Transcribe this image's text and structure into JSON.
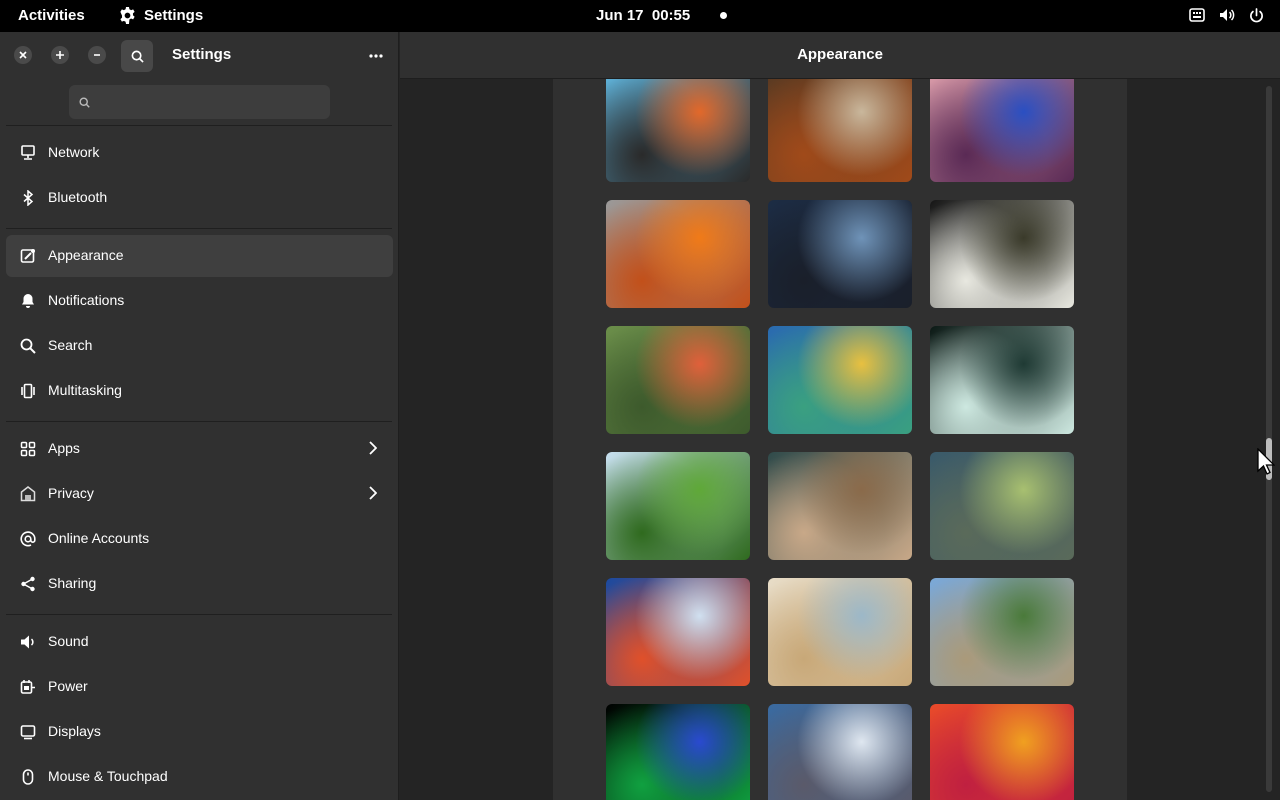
{
  "topbar": {
    "activities": "Activities",
    "app_name": "Settings",
    "clock": "Jun 17  00:55"
  },
  "sidebar": {
    "title": "Settings",
    "search_placeholder": "",
    "groups": [
      [
        {
          "label": "Network",
          "icon": "network-icon"
        },
        {
          "label": "Bluetooth",
          "icon": "bluetooth-icon"
        }
      ],
      [
        {
          "label": "Appearance",
          "icon": "appearance-icon",
          "active": true
        },
        {
          "label": "Notifications",
          "icon": "bell-icon"
        },
        {
          "label": "Search",
          "icon": "search-icon"
        },
        {
          "label": "Multitasking",
          "icon": "multitasking-icon"
        }
      ],
      [
        {
          "label": "Apps",
          "icon": "apps-icon",
          "chevron": true
        },
        {
          "label": "Privacy",
          "icon": "privacy-icon",
          "chevron": true
        },
        {
          "label": "Online Accounts",
          "icon": "at-icon"
        },
        {
          "label": "Sharing",
          "icon": "share-icon"
        }
      ],
      [
        {
          "label": "Sound",
          "icon": "speaker-icon"
        },
        {
          "label": "Power",
          "icon": "power-plug-icon"
        },
        {
          "label": "Displays",
          "icon": "display-icon"
        },
        {
          "label": "Mouse & Touchpad",
          "icon": "mouse-icon"
        }
      ]
    ]
  },
  "main": {
    "title": "Appearance"
  },
  "wallpapers": [
    {
      "name": "graffiti-wallpaper",
      "colors": [
        "#5fb2d9",
        "#e2682a",
        "#2a2a2a"
      ]
    },
    {
      "name": "mushrooms-wallpaper",
      "colors": [
        "#5a3a22",
        "#c9b79c",
        "#a04a1a"
      ]
    },
    {
      "name": "turntable-wallpaper",
      "colors": [
        "#d89aa8",
        "#2a4fc2",
        "#5a2a55"
      ]
    },
    {
      "name": "orange-flower-wallpaper",
      "colors": [
        "#9a9a9a",
        "#f07a18",
        "#c2501a"
      ]
    },
    {
      "name": "moonlit-sea-wallpaper",
      "colors": [
        "#1c2c44",
        "#6f93b8",
        "#1a1f2a"
      ]
    },
    {
      "name": "night-city-wallpaper",
      "colors": [
        "#151515",
        "#3a3a2a",
        "#e8e8e0"
      ]
    },
    {
      "name": "poppies-wallpaper",
      "colors": [
        "#6b8e4a",
        "#e0603a",
        "#3d5a2c"
      ]
    },
    {
      "name": "colorful-rope-wallpaper",
      "colors": [
        "#2a6ab0",
        "#e8c040",
        "#3aa080"
      ]
    },
    {
      "name": "dark-water-wallpaper",
      "colors": [
        "#0a1814",
        "#1f3a34",
        "#cde8e0"
      ]
    },
    {
      "name": "green-leaves-wallpaper",
      "colors": [
        "#c8e0f0",
        "#5fa838",
        "#2f6a1e"
      ]
    },
    {
      "name": "otter-wallpaper",
      "colors": [
        "#2f4a4a",
        "#8a6a4a",
        "#c8a888"
      ]
    },
    {
      "name": "alpine-lake-wallpaper",
      "colors": [
        "#3a5a6a",
        "#a8c070",
        "#5a6a5a"
      ]
    },
    {
      "name": "striped-blue-red-wallpaper",
      "colors": [
        "#1a4aa0",
        "#d0e0f0",
        "#e0502a"
      ]
    },
    {
      "name": "rope-beach-wallpaper",
      "colors": [
        "#e8ddc8",
        "#9cb8c8",
        "#c8a878"
      ]
    },
    {
      "name": "mountain-valley-wallpaper",
      "colors": [
        "#7aa8d8",
        "#4a7a3a",
        "#aa9a7a"
      ]
    },
    {
      "name": "blue-light-wallpaper",
      "colors": [
        "#000000",
        "#2a4ad0",
        "#10a040"
      ]
    },
    {
      "name": "snowy-peaks-wallpaper",
      "colors": [
        "#3a6aa0",
        "#dfe7f0",
        "#5a5a6a"
      ]
    },
    {
      "name": "orange-bokeh-wallpaper",
      "colors": [
        "#e84a2a",
        "#f0a020",
        "#c02040"
      ]
    }
  ]
}
